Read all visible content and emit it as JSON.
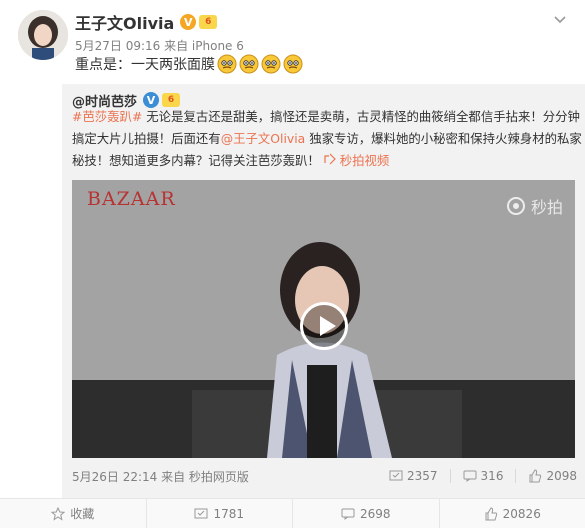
{
  "post": {
    "author": "王子文Olivia",
    "vip_badge": "V",
    "level_badge": "6",
    "meta": "5月27日 09:16 来自 iPhone 6",
    "text": "重点是：一天两张面膜"
  },
  "repost": {
    "orig_author": "@时尚芭莎",
    "hashtag": "#芭莎轰趴#",
    "text_a": " 无论是复古还是甜美，搞怪还是卖萌，古灵精怪的曲筱绡全都信手拈来！分分钟搞定大片儿拍摄！后面还有",
    "mention": "@王子文Olivia",
    "text_b": " 独家专访，爆料她的小秘密和保持火辣身材的私家秘技！想知道更多内幕？记得关注芭莎轰趴！",
    "video_link": "秒拍视频",
    "video_brand": "BAZAAR",
    "video_watermark": "秒拍",
    "meta": "5月26日 22:14 来自 秒拍网页版",
    "repost_count": "2357",
    "comment_count": "316",
    "like_count": "2098"
  },
  "actions": {
    "favorite_label": "收藏",
    "repost_label": "1781",
    "comment_label": "2698",
    "like_label": "20826"
  },
  "colors": {
    "link": "#eb7350",
    "accent_badge": "#f5a623"
  }
}
